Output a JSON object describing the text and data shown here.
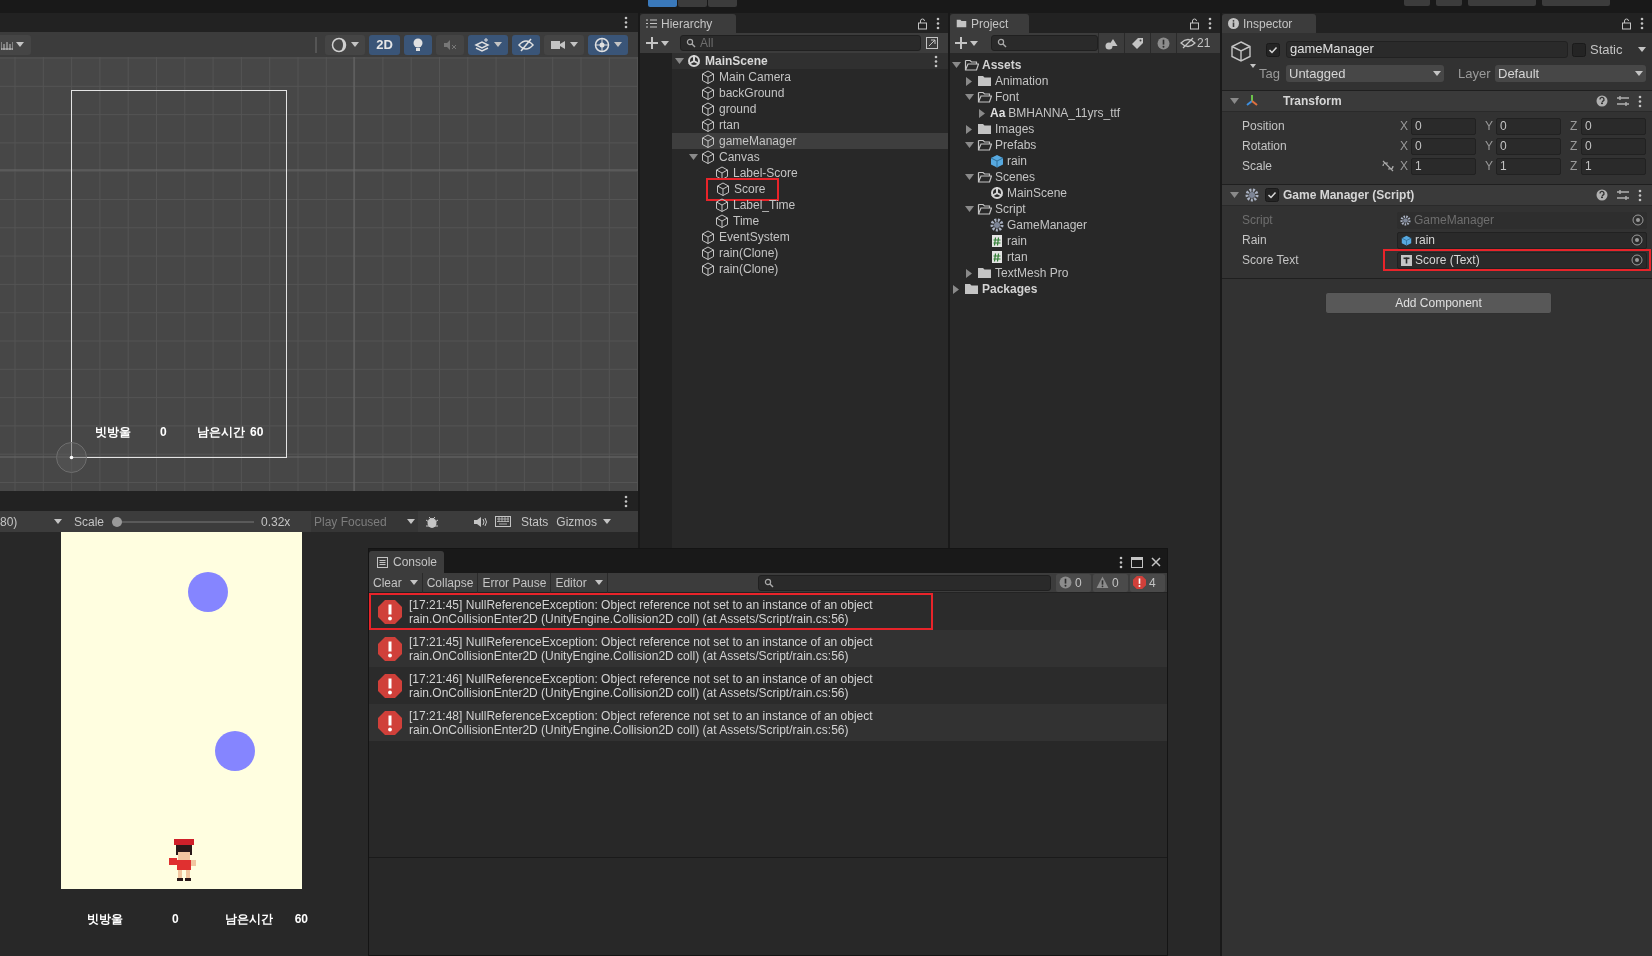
{
  "top_toolbar": {
    "play_controls": [
      {
        "on": true
      },
      {
        "on": false
      },
      {
        "on": false
      }
    ]
  },
  "scene": {
    "toolbar": [
      {
        "kind": "shading",
        "on": false
      },
      {
        "kind": "dimension",
        "label": "2D",
        "on": true
      },
      {
        "kind": "lighting",
        "on": true
      },
      {
        "kind": "audio",
        "on": false
      },
      {
        "kind": "effects",
        "on": true
      },
      {
        "kind": "visibility",
        "on": true
      },
      {
        "kind": "camera",
        "on": false
      },
      {
        "kind": "gizmos",
        "on": true
      }
    ],
    "hud": [
      "빗방울",
      "0",
      "남은시간",
      "60"
    ]
  },
  "game": {
    "aspect": "80)",
    "scale_label": "Scale",
    "scale": {
      "level": 0
    },
    "scale_reading": "0.32x",
    "play_mode": "Play Focused",
    "stats": "Stats",
    "gizmos": "Gizmos",
    "hud": [
      "빗방울",
      "0",
      "남은시간",
      "60"
    ]
  },
  "hierarchy": {
    "title": "Hierarchy",
    "search_placeholder": "All",
    "scene": {
      "name": "MainScene",
      "expanded": true,
      "children": [
        {
          "name": "Main Camera",
          "selected": false
        },
        {
          "name": "backGround",
          "selected": false
        },
        {
          "name": "ground",
          "selected": false
        },
        {
          "name": "rtan",
          "selected": false
        },
        {
          "name": "gameManager",
          "selected": true
        },
        {
          "name": "Canvas",
          "selected": false,
          "expanded": true,
          "children": [
            {
              "name": "Label-Score",
              "selected": false
            },
            {
              "name": "Score",
              "selected": false,
              "annotated": true
            },
            {
              "name": "Label_Time",
              "selected": false
            },
            {
              "name": "Time",
              "selected": false
            }
          ]
        },
        {
          "name": "EventSystem",
          "selected": false
        },
        {
          "name": "rain(Clone)",
          "selected": false
        },
        {
          "name": "rain(Clone)",
          "selected": false
        }
      ]
    }
  },
  "project": {
    "title": "Project",
    "hidden_count": "21",
    "tree": [
      {
        "name": "Assets",
        "kind": "folder",
        "expanded": true,
        "children": [
          {
            "name": "Animation",
            "kind": "folder",
            "expanded": false
          },
          {
            "name": "Font",
            "kind": "folder",
            "expanded": true,
            "children": [
              {
                "name": "BMHANNA_11yrs_ttf",
                "kind": "font",
                "icon_text": "Aa",
                "expanded": false
              }
            ]
          },
          {
            "name": "Images",
            "kind": "folder",
            "expanded": false
          },
          {
            "name": "Prefabs",
            "kind": "folder",
            "expanded": true,
            "children": [
              {
                "name": "rain",
                "kind": "prefab"
              }
            ]
          },
          {
            "name": "Scenes",
            "kind": "folder",
            "expanded": true,
            "children": [
              {
                "name": "MainScene",
                "kind": "scene"
              }
            ]
          },
          {
            "name": "Script",
            "kind": "folder",
            "expanded": true,
            "children": [
              {
                "name": "GameManager",
                "kind": "gear"
              },
              {
                "name": "rain",
                "kind": "csharp"
              },
              {
                "name": "rtan",
                "kind": "csharp"
              }
            ]
          },
          {
            "name": "TextMesh Pro",
            "kind": "folder",
            "expanded": false
          }
        ]
      },
      {
        "name": "Packages",
        "kind": "folder",
        "expanded": false
      }
    ]
  },
  "inspector": {
    "title": "Inspector",
    "object": {
      "active": true,
      "name": "gameManager",
      "static": false,
      "static_label": "Static",
      "tag_label": "Tag",
      "tag": "Untagged",
      "layer_label": "Layer",
      "layer": "Default"
    },
    "components": [
      {
        "kind": "transform",
        "title": "Transform",
        "rows": [
          {
            "label": "Position",
            "linkable": false,
            "axes": [
              "X",
              "Y",
              "Z"
            ],
            "values": [
              "0",
              "0",
              "0"
            ]
          },
          {
            "label": "Rotation",
            "linkable": false,
            "axes": [
              "X",
              "Y",
              "Z"
            ],
            "values": [
              "0",
              "0",
              "0"
            ]
          },
          {
            "label": "Scale",
            "linkable": true,
            "axes": [
              "X",
              "Y",
              "Z"
            ],
            "values": [
              "1",
              "1",
              "1"
            ]
          }
        ]
      },
      {
        "kind": "script",
        "title": "Game Manager (Script)",
        "enabled": true,
        "fields": [
          {
            "label": "Script",
            "value": "GameManager",
            "kind": "script",
            "disabled": true
          },
          {
            "label": "Rain",
            "value": "rain",
            "kind": "prefab",
            "disabled": false
          },
          {
            "label": "Score Text",
            "value": "Score (Text)",
            "kind": "text",
            "disabled": false,
            "annotated": true
          }
        ]
      }
    ],
    "add_button": "Add Component"
  },
  "console": {
    "title": "Console",
    "toolbar": [
      {
        "label": "Clear",
        "dropdown": true
      },
      {
        "label": "Collapse",
        "dropdown": false
      },
      {
        "label": "Error Pause",
        "dropdown": false
      },
      {
        "label": "Editor",
        "dropdown": true
      }
    ],
    "counts": [
      {
        "kind": "info",
        "count": "0"
      },
      {
        "kind": "warning",
        "count": "0"
      },
      {
        "kind": "error",
        "count": "4"
      }
    ],
    "entries": [
      {
        "kind": "error",
        "annotated": true,
        "lines": [
          "[17:21:45] NullReferenceException: Object reference not set to an instance of an object",
          "rain.OnCollisionEnter2D (UnityEngine.Collision2D coll) (at Assets/Script/rain.cs:56)"
        ]
      },
      {
        "kind": "error",
        "lines": [
          "[17:21:45] NullReferenceException: Object reference not set to an instance of an object",
          "rain.OnCollisionEnter2D (UnityEngine.Collision2D coll) (at Assets/Script/rain.cs:56)"
        ]
      },
      {
        "kind": "error",
        "lines": [
          "[17:21:46] NullReferenceException: Object reference not set to an instance of an object",
          "rain.OnCollisionEnter2D (UnityEngine.Collision2D coll) (at Assets/Script/rain.cs:56)"
        ]
      },
      {
        "kind": "error",
        "lines": [
          "[17:21:48] NullReferenceException: Object reference not set to an instance of an object",
          "rain.OnCollisionEnter2D (UnityEngine.Collision2D coll) (at Assets/Script/rain.cs:56)"
        ]
      }
    ]
  }
}
